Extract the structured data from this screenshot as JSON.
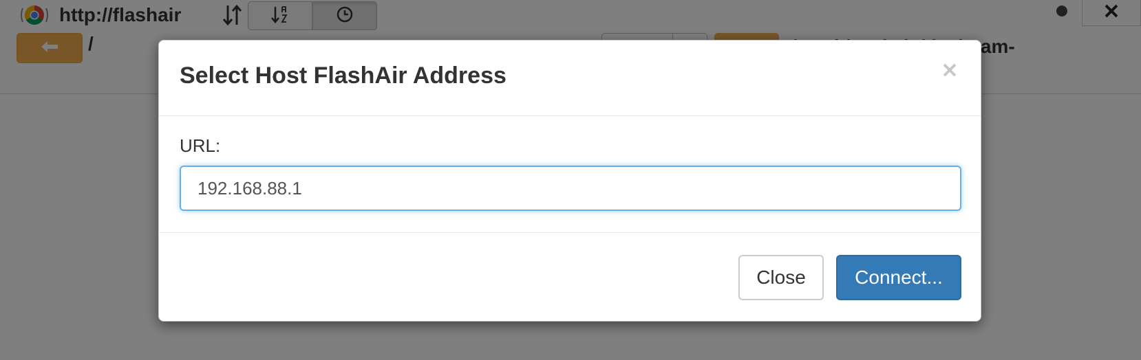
{
  "toolbar": {
    "host_text": "http://flashair",
    "path_text": "/",
    "right_path": "/Work/Node.js/dashcam-"
  },
  "modal": {
    "title": "Select Host FlashAir Address",
    "url_label": "URL:",
    "url_value": "192.168.88.1",
    "close_label": "Close",
    "connect_label": "Connect..."
  },
  "icons": {
    "app": "chrome-broadcast-icon",
    "sort": "sort-toggle-icon",
    "alpha_sort": "sort-alpha-icon",
    "time_sort": "clock-icon",
    "back": "arrow-left-icon",
    "window_close": "close-icon",
    "modal_close": "close-icon"
  },
  "colors": {
    "warning": "#f0ad4e",
    "primary": "#337ab7",
    "focus": "#66afe9"
  }
}
